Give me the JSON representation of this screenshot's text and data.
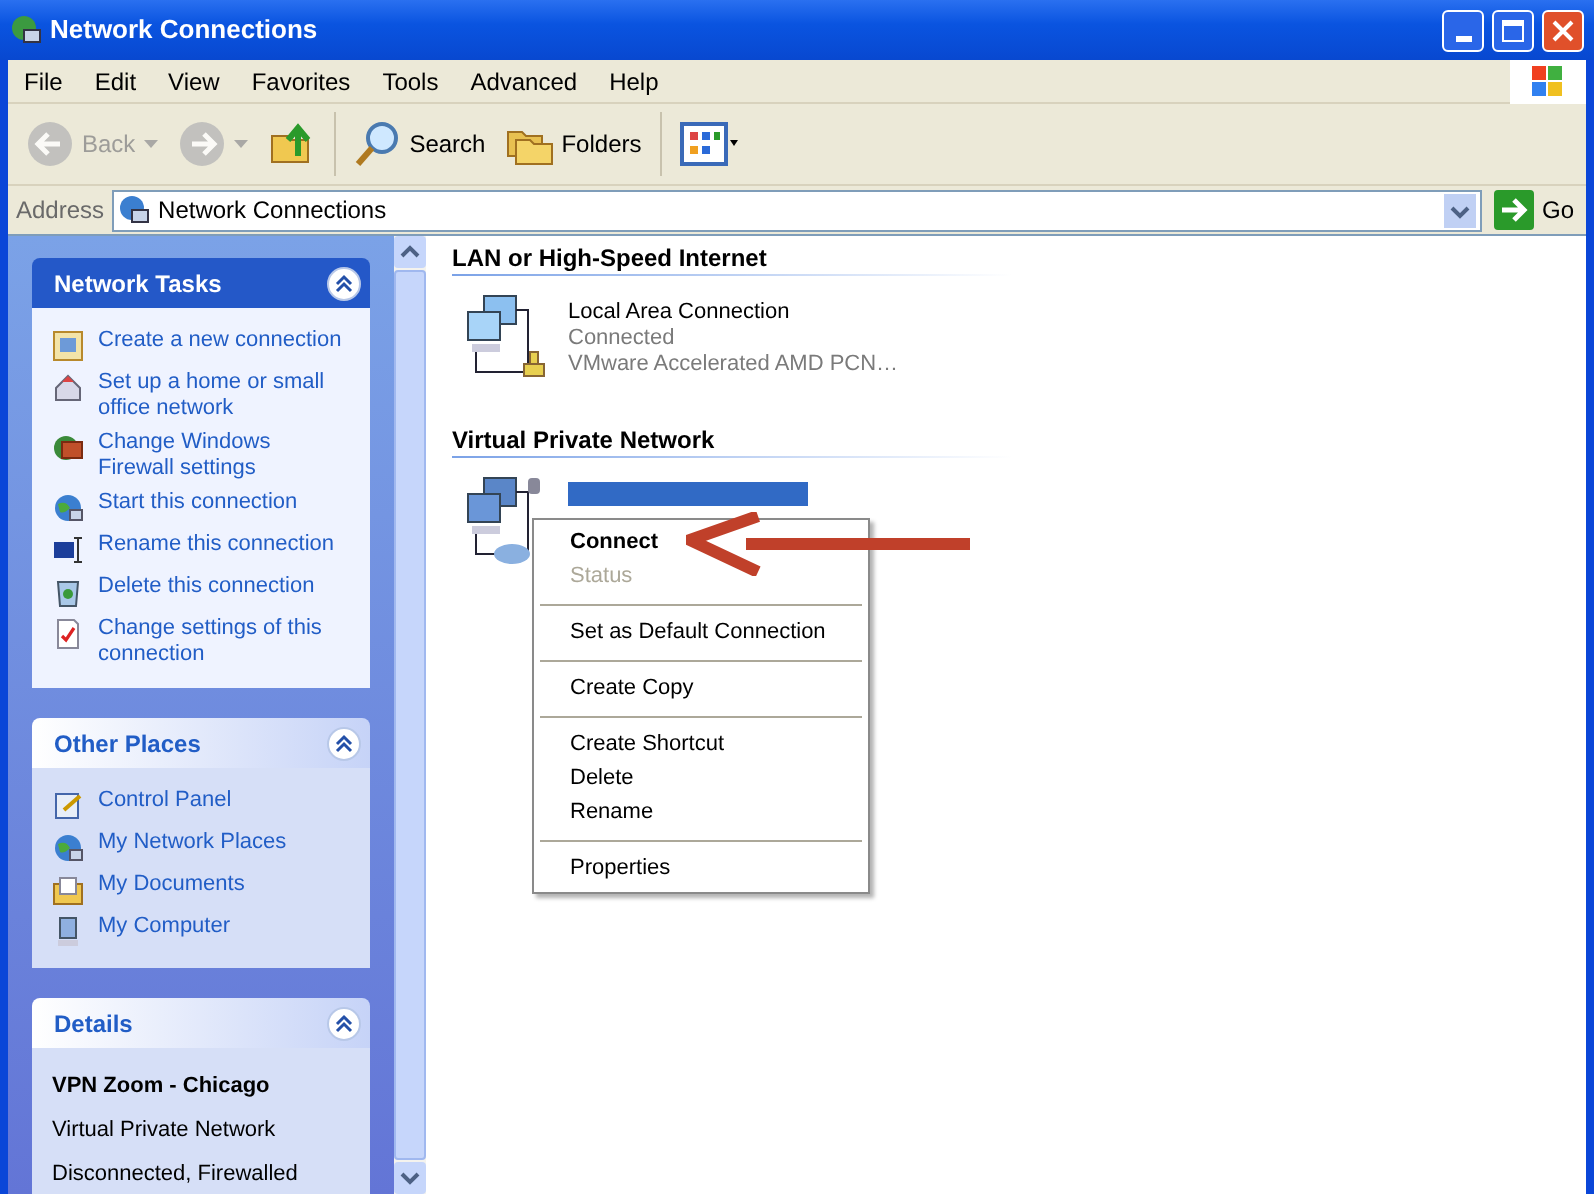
{
  "window": {
    "title": "Network Connections"
  },
  "menu": [
    "File",
    "Edit",
    "View",
    "Favorites",
    "Tools",
    "Advanced",
    "Help"
  ],
  "toolbar": [
    {
      "kind": "back",
      "label": "Back",
      "disabled": true
    },
    {
      "kind": "forward",
      "disabled": true
    },
    {
      "kind": "up",
      "disabled": false
    },
    {
      "kind": "search",
      "label": "Search",
      "disabled": false
    },
    {
      "kind": "folders",
      "label": "Folders",
      "disabled": false
    },
    {
      "kind": "views",
      "disabled": false
    }
  ],
  "address": {
    "label": "Address",
    "value": "Network Connections",
    "go": "Go"
  },
  "panels": [
    {
      "title": "Network Tasks",
      "highlighted": true,
      "kind": "links",
      "items": [
        {
          "kind": "new",
          "label": "Create a new connection"
        },
        {
          "kind": "home",
          "label": "Set up a home or small office network"
        },
        {
          "kind": "firewall",
          "label": "Change Windows Firewall settings"
        },
        {
          "kind": "globe",
          "label": "Start this connection"
        },
        {
          "kind": "rename",
          "label": "Rename this connection"
        },
        {
          "kind": "delete",
          "label": "Delete this connection"
        },
        {
          "kind": "settings",
          "label": "Change settings of this connection"
        }
      ]
    },
    {
      "title": "Other Places",
      "highlighted": false,
      "kind": "links",
      "items": [
        {
          "kind": "control",
          "label": "Control Panel"
        },
        {
          "kind": "globe",
          "label": "My Network Places"
        },
        {
          "kind": "docs",
          "label": "My Documents"
        },
        {
          "kind": "computer",
          "label": "My Computer"
        }
      ]
    },
    {
      "title": "Details",
      "highlighted": false,
      "kind": "details",
      "lines": [
        {
          "text": "VPN Zoom - Chicago",
          "bold": true
        },
        {
          "text": "Virtual Private Network",
          "bold": false
        },
        {
          "text": "Disconnected, Firewalled",
          "bold": false
        }
      ]
    }
  ],
  "groups": [
    {
      "title": "LAN or High-Speed Internet",
      "items": [
        {
          "kind": "lan",
          "selected": false,
          "name": "Local Area Connection",
          "lines": [
            "Connected",
            "VMware Accelerated AMD PCN…"
          ]
        }
      ]
    },
    {
      "title": "Virtual Private Network",
      "items": [
        {
          "kind": "vpn",
          "selected": true
        }
      ]
    }
  ],
  "context_menu": {
    "items": [
      {
        "kind": "item",
        "label": "Connect",
        "bold": true,
        "disabled": false
      },
      {
        "kind": "item",
        "label": "Status",
        "bold": false,
        "disabled": true
      },
      {
        "kind": "separator"
      },
      {
        "kind": "item",
        "label": "Set as Default Connection",
        "bold": false,
        "disabled": false
      },
      {
        "kind": "separator"
      },
      {
        "kind": "item",
        "label": "Create Copy",
        "bold": false,
        "disabled": false
      },
      {
        "kind": "separator"
      },
      {
        "kind": "item",
        "label": "Create Shortcut",
        "bold": false,
        "disabled": false
      },
      {
        "kind": "item",
        "label": "Delete",
        "bold": false,
        "disabled": false
      },
      {
        "kind": "item",
        "label": "Rename",
        "bold": false,
        "disabled": false
      },
      {
        "kind": "separator"
      },
      {
        "kind": "item",
        "label": "Properties",
        "bold": false,
        "disabled": false
      }
    ]
  },
  "annotation": {
    "kind": "arrow"
  }
}
